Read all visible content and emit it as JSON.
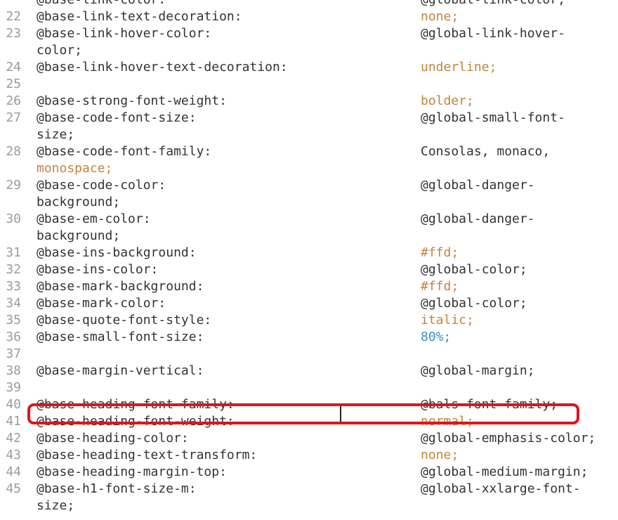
{
  "lines": [
    {
      "num": "",
      "prop": "@base-link-color:",
      "value": "@global-link-color;",
      "kind": "plain"
    },
    {
      "num": "22",
      "prop": "@base-link-text-decoration:",
      "value": "none;",
      "kind": "kw"
    },
    {
      "num": "23",
      "prop": "@base-link-hover-color:",
      "value": "@global-link-hover-",
      "kind": "plain"
    },
    {
      "num": "",
      "prop": "color;",
      "value": "",
      "kind": "plain"
    },
    {
      "num": "24",
      "prop": "@base-link-hover-text-decoration:",
      "value": "underline;",
      "kind": "kw"
    },
    {
      "num": "25",
      "prop": "",
      "value": "",
      "kind": "plain"
    },
    {
      "num": "26",
      "prop": "@base-strong-font-weight:",
      "value": "bolder;",
      "kind": "kw"
    },
    {
      "num": "27",
      "prop": "@base-code-font-size:",
      "value": "@global-small-font-",
      "kind": "plain"
    },
    {
      "num": "",
      "prop": "size;",
      "value": "",
      "kind": "plain"
    },
    {
      "num": "28",
      "prop": "@base-code-font-family:",
      "value": "Consolas, monaco,",
      "kind": "plain"
    },
    {
      "num": "",
      "prop": "monospace;",
      "value": "",
      "kind": "kw-left"
    },
    {
      "num": "29",
      "prop": "@base-code-color:",
      "value": "@global-danger-",
      "kind": "plain"
    },
    {
      "num": "",
      "prop": "background;",
      "value": "",
      "kind": "plain"
    },
    {
      "num": "30",
      "prop": "@base-em-color:",
      "value": "@global-danger-",
      "kind": "plain"
    },
    {
      "num": "",
      "prop": "background;",
      "value": "",
      "kind": "plain"
    },
    {
      "num": "31",
      "prop": "@base-ins-background:",
      "value": "#ffd;",
      "kind": "kw"
    },
    {
      "num": "32",
      "prop": "@base-ins-color:",
      "value": "@global-color;",
      "kind": "plain"
    },
    {
      "num": "33",
      "prop": "@base-mark-background:",
      "value": "#ffd;",
      "kind": "kw"
    },
    {
      "num": "34",
      "prop": "@base-mark-color:",
      "value": "@global-color;",
      "kind": "plain"
    },
    {
      "num": "35",
      "prop": "@base-quote-font-style:",
      "value": "italic;",
      "kind": "kw"
    },
    {
      "num": "36",
      "prop": "@base-small-font-size:",
      "value": "80%;",
      "kind": "num"
    },
    {
      "num": "37",
      "prop": "",
      "value": "",
      "kind": "plain"
    },
    {
      "num": "38",
      "prop": "@base-margin-vertical:",
      "value": "@global-margin;",
      "kind": "plain"
    },
    {
      "num": "39",
      "prop": "",
      "value": "",
      "kind": "plain"
    },
    {
      "num": "40",
      "prop": "@base-heading-font-family:",
      "value": "@bals-font-family;",
      "kind": "plain"
    },
    {
      "num": "41",
      "prop": "@base-heading-font-weight:",
      "value": "normal;",
      "kind": "kw"
    },
    {
      "num": "42",
      "prop": "@base-heading-color:",
      "value": "@global-emphasis-color;",
      "kind": "plain"
    },
    {
      "num": "43",
      "prop": "@base-heading-text-transform:",
      "value": "none;",
      "kind": "kw"
    },
    {
      "num": "44",
      "prop": "@base-heading-margin-top:",
      "value": "@global-medium-margin;",
      "kind": "plain"
    },
    {
      "num": "45",
      "prop": "@base-h1-font-size-m:",
      "value": "@global-xxlarge-font-",
      "kind": "plain"
    },
    {
      "num": "",
      "prop": "size;",
      "value": "",
      "kind": "plain"
    }
  ],
  "colors": {
    "keyword": "#c5843c",
    "number": "#3a8fc9",
    "highlight_border": "#e0141b",
    "line_number": "#9b9b9b"
  }
}
